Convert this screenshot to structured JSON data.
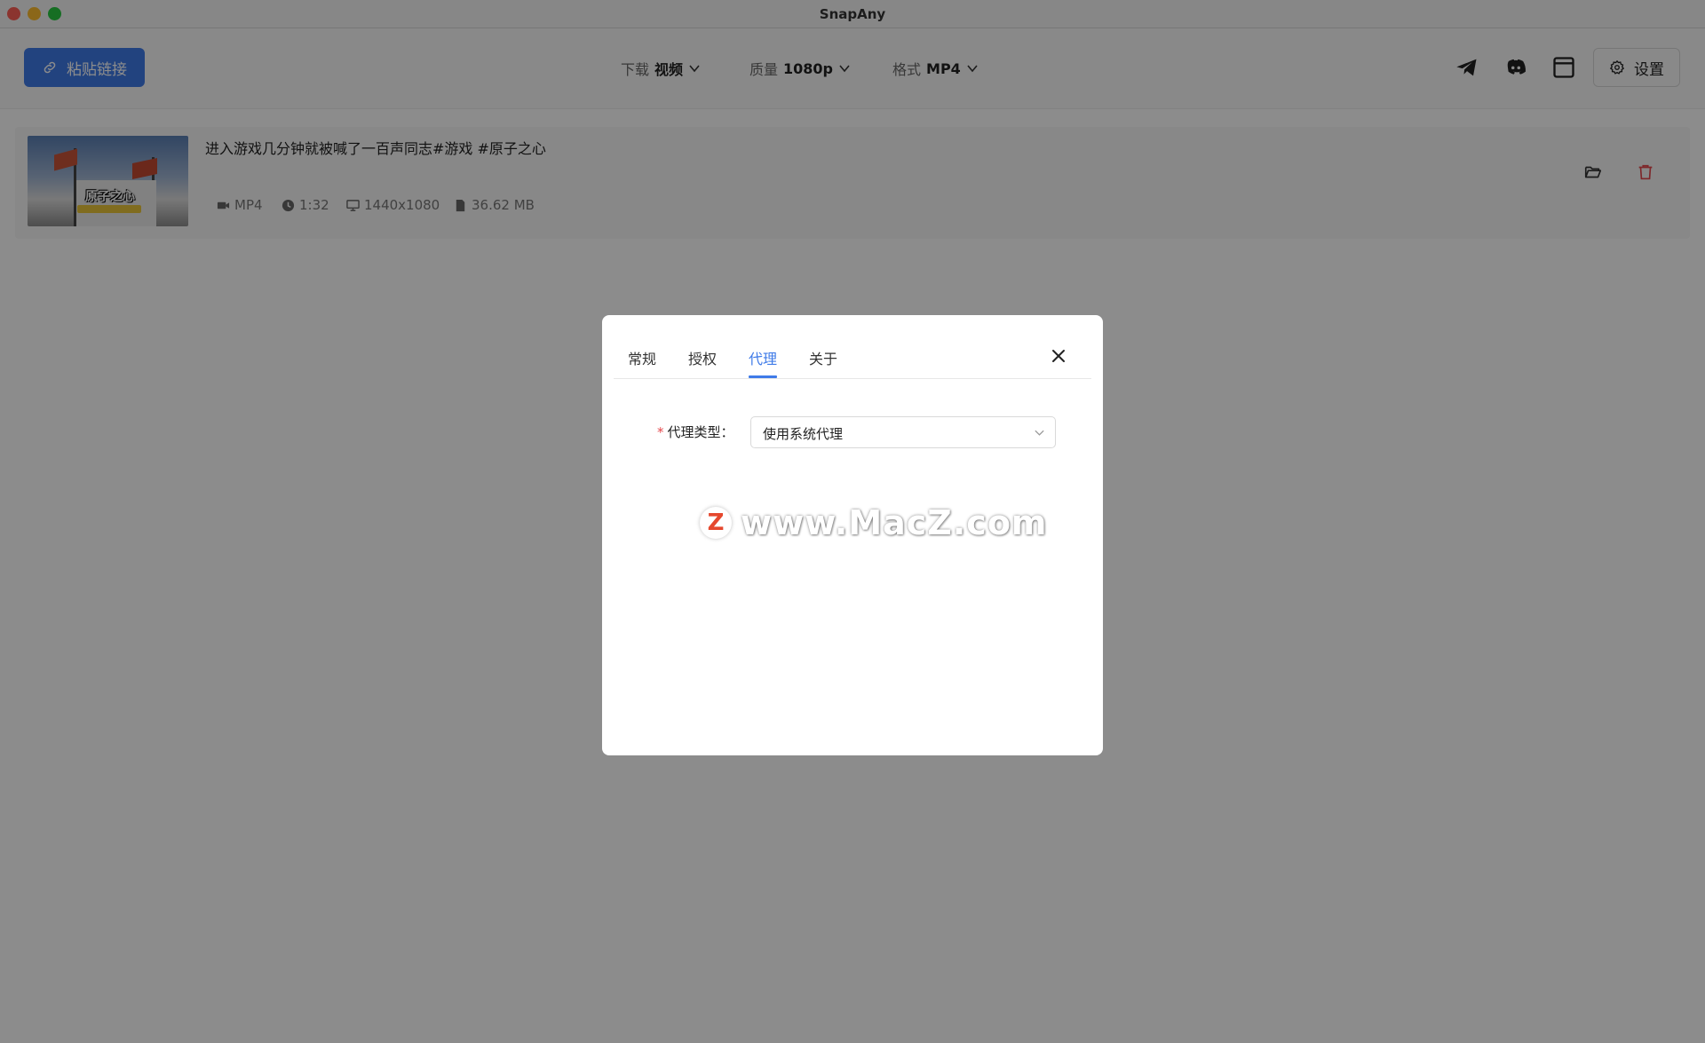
{
  "window": {
    "title": "SnapAny"
  },
  "toolbar": {
    "paste_label": "粘贴链接",
    "download": {
      "label": "下载",
      "value": "视频"
    },
    "quality": {
      "label": "质量",
      "value": "1080p"
    },
    "format": {
      "label": "格式",
      "value": "MP4"
    },
    "settings_label": "设置",
    "icons": [
      "telegram-icon",
      "discord-icon",
      "window-icon",
      "gear-icon"
    ]
  },
  "item": {
    "title": "进入游戏几分钟就被喊了一百声同志#游戏 #原子之心",
    "thumbnail_text": "原子之心",
    "format": "MP4",
    "duration": "1:32",
    "resolution": "1440x1080",
    "size": "36.62 MB"
  },
  "dialog": {
    "tabs": [
      {
        "label": "常规",
        "active": false
      },
      {
        "label": "授权",
        "active": false
      },
      {
        "label": "代理",
        "active": true
      },
      {
        "label": "关于",
        "active": false
      }
    ],
    "form": {
      "required_mark": "*",
      "proxy_type_label": "代理类型：",
      "proxy_type_value": "使用系统代理"
    }
  },
  "watermark": {
    "badge": "Z",
    "text": "www.MacZ.com"
  },
  "colors": {
    "accent": "#3f7be8",
    "danger": "#e5484d",
    "overlay": "rgba(0,0,0,0.45)"
  }
}
